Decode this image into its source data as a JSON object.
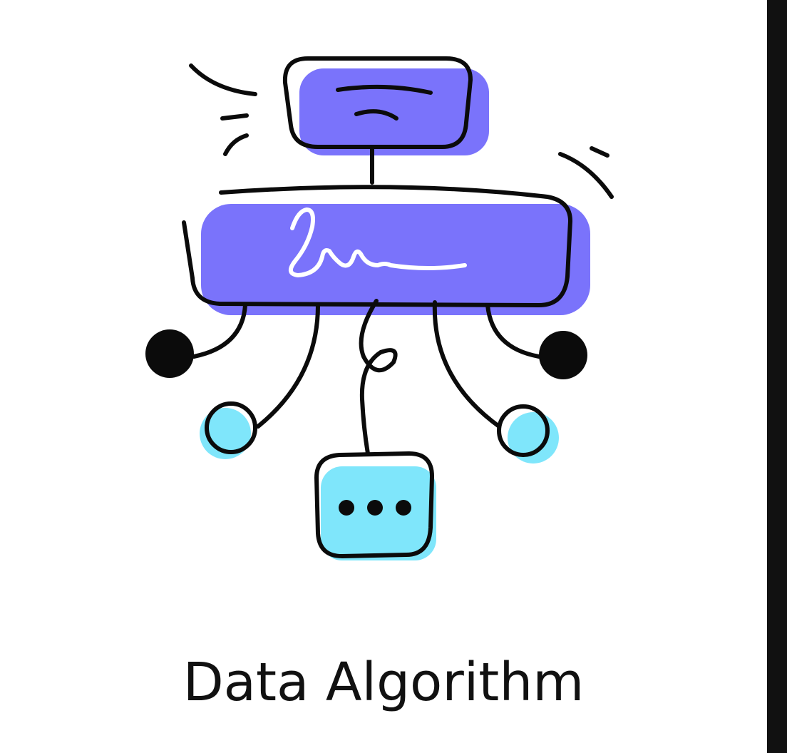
{
  "caption": "Data Algorithm",
  "icon": {
    "name": "data-algorithm-icon",
    "colors": {
      "purple": "#7a73fb",
      "cyan": "#7fe6fb",
      "ink": "#0b0b0b",
      "background": "#ffffff",
      "edge_bar": "#111111"
    },
    "parts": [
      "top-node-icon",
      "main-bar-icon",
      "signature-icon",
      "dot-node-icon",
      "circle-node-icon",
      "chat-bubble-icon",
      "motion-lines-icon"
    ]
  }
}
